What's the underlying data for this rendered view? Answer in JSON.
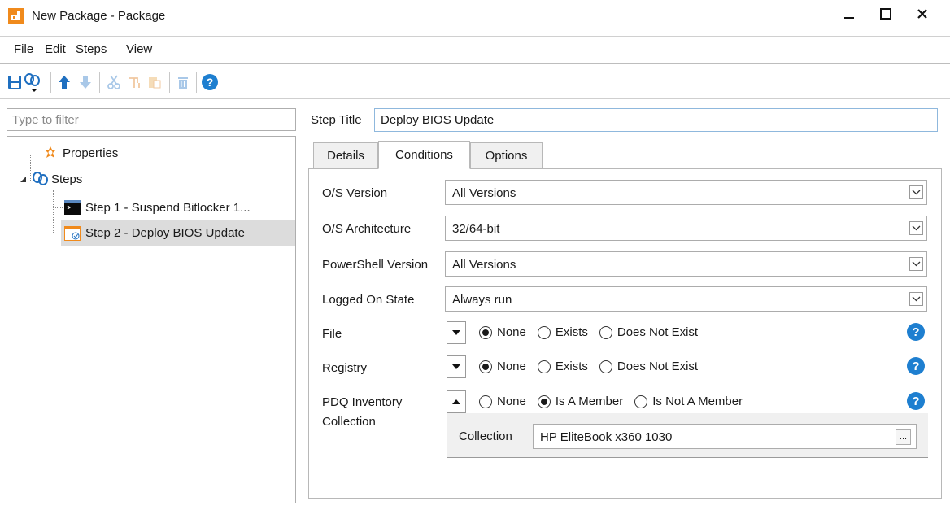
{
  "window": {
    "title": "New Package - Package",
    "app_icon": "pdq-deploy-icon",
    "controls": [
      "minimize-icon",
      "maximize-icon",
      "close-icon"
    ]
  },
  "menu": {
    "file": "File",
    "edit": "Edit",
    "steps": "Steps",
    "view": "View"
  },
  "toolbar": {
    "icons": [
      "save-icon",
      "add-step-icon",
      "move-up-icon",
      "move-down-icon",
      "cut-icon",
      "copy-icon",
      "paste-icon",
      "delete-icon",
      "help-icon"
    ]
  },
  "filter": {
    "placeholder": "Type to filter"
  },
  "tree": {
    "properties": "Properties",
    "steps": "Steps",
    "items": [
      {
        "label": "Step 1 - Suspend Bitlocker 1...",
        "icon": "powershell-icon"
      },
      {
        "label": "Step 2 - Deploy BIOS Update",
        "icon": "install-step-icon",
        "selected": true
      }
    ]
  },
  "step_title": {
    "label": "Step Title",
    "value": "Deploy BIOS Update"
  },
  "tabs": {
    "details": "Details",
    "conditions": "Conditions",
    "options": "Options",
    "active": "Conditions"
  },
  "conditions": {
    "os_version": {
      "label": "O/S Version",
      "value": "All Versions"
    },
    "os_architecture": {
      "label": "O/S Architecture",
      "value": "32/64-bit"
    },
    "powershell_version": {
      "label": "PowerShell Version",
      "value": "All Versions"
    },
    "logged_on_state": {
      "label": "Logged On State",
      "value": "Always run"
    },
    "file": {
      "label": "File",
      "options": [
        "None",
        "Exists",
        "Does Not Exist"
      ],
      "selected": "None"
    },
    "registry": {
      "label": "Registry",
      "options": [
        "None",
        "Exists",
        "Does Not Exist"
      ],
      "selected": "None"
    },
    "pdq_inventory": {
      "label_line1": "PDQ Inventory",
      "label_line2": "Collection",
      "options": [
        "None",
        "Is A Member",
        "Is Not A Member"
      ],
      "selected": "Is A Member",
      "collection_label": "Collection",
      "collection_value": "HP EliteBook x360 1030",
      "browse_label": "..."
    }
  },
  "colors": {
    "accent": "#1e7fd0",
    "app_icon": "#f08a1c",
    "selection": "#dcdcdc"
  }
}
